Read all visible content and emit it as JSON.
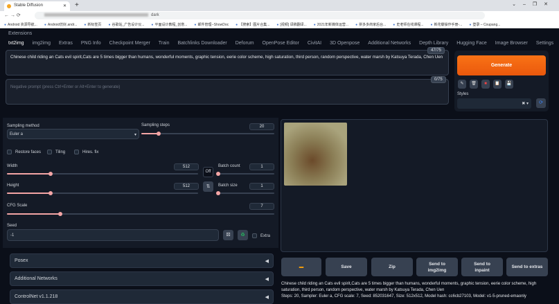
{
  "browser": {
    "tab_title": "Stable Diffusion",
    "url_suffix": "dark",
    "bookmarks": [
      "Android 资源导航...",
      "Android仿好,andr...",
      "新标签页",
      "谷歌站_广告设计仪...",
      "平面设计教程_创意...",
      "邮件管理--ShowDoc",
      "【搜索】图片合集...",
      "[视频] 译稿翻译...",
      "2021年新媒体运营...",
      "拼多多商家后台...",
      "史老师在线课程...",
      "新花瓣操作手册-...",
      "登录 – Coupang..."
    ]
  },
  "app": {
    "extensions_label": "Extensions",
    "tabs": [
      "txt2img",
      "img2img",
      "Extras",
      "PNG Info",
      "Checkpoint Merger",
      "Train",
      "Batchlinks Downloader",
      "Deforum",
      "OpenPose Editor",
      "CivitAI",
      "3D Openpose",
      "Additional Networks",
      "Depth Library",
      "Hugging Face",
      "Image Browser",
      "Settings"
    ]
  },
  "prompt": {
    "value": "Chinese child riding an Cats evil spirit,Cats are 5 times bigger than humans, wonderful moments, graphic tension, eerie color scheme, high saturation, third person, random perspective, water marsh by Katsuya Terada, Chen Uen",
    "count": "47/75"
  },
  "negative": {
    "placeholder": "Negative prompt (press Ctrl+Enter or Alt+Enter to generate)",
    "count": "0/75"
  },
  "generate": {
    "label": "Generate",
    "styles_label": "Styles"
  },
  "params": {
    "sampling_method_label": "Sampling method",
    "sampling_method": "Euler a",
    "sampling_steps_label": "Sampling steps",
    "sampling_steps": "20",
    "restore_faces": "Restore faces",
    "tiling": "Tiling",
    "hires_fix": "Hires. fix",
    "width_label": "Width",
    "width": "512",
    "height_label": "Height",
    "height": "512",
    "batch_count_label": "Batch count",
    "batch_count": "1",
    "batch_size_label": "Batch size",
    "batch_size": "1",
    "cfg_label": "CFG Scale",
    "cfg": "7",
    "seed_label": "Seed",
    "seed": "-1",
    "extra_label": "Extra",
    "off_label": "Off",
    "swap_label": "⇅",
    "slider_fractions": {
      "steps": 0.13,
      "width": 0.23,
      "height": 0.23,
      "batch_count": 0.0,
      "batch_size": 0.0,
      "cfg": 0.2
    }
  },
  "accordions": [
    "Posex",
    "Additional Networks",
    "ControlNet v1.1.218"
  ],
  "output": {
    "buttons": [
      "Save",
      "Zip",
      "Send to img2img",
      "Send to inpaint",
      "Send to extras"
    ],
    "info_prompt": "Chinese child riding an Cats evil spirit,Cats are 5 times bigger than humans, wonderful moments, graphic tension, eerie color scheme, high saturation, third person, random perspective, water marsh by Katsuya Terada, Chen Uen",
    "info_params": "Steps: 20, Sampler: Euler a, CFG scale: 7, Seed: 852031647, Size: 512x512, Model hash: cc6cb27103, Model: v1-5-pruned-emaonly"
  }
}
